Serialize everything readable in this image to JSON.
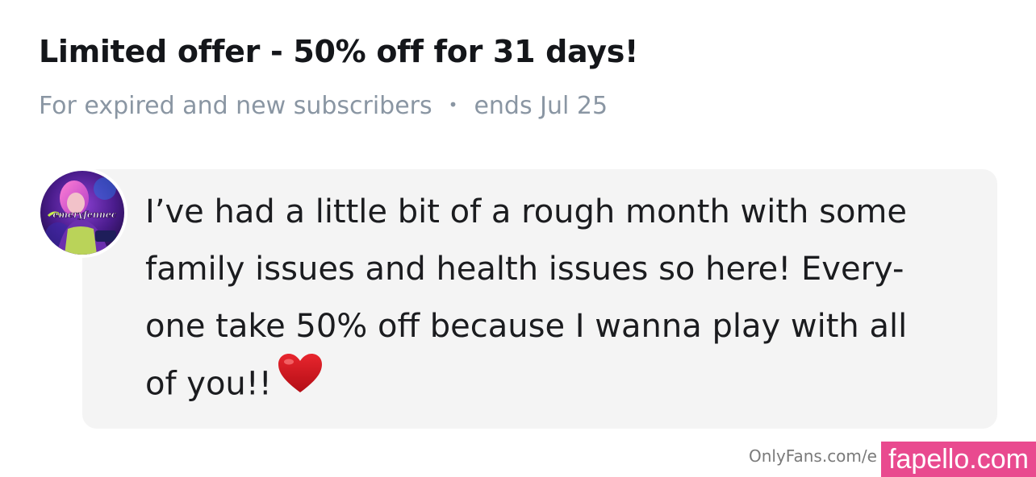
{
  "offer": {
    "title": "Limited offer - 50% off for 31 days!",
    "audience": "For expired and new subscribers",
    "separator": "•",
    "ends": "ends Jul 25"
  },
  "avatar": {
    "logo_text": "emeryfennec"
  },
  "message": {
    "lines": [
      "I’ve had a little bit of a rough month with some",
      "family issues and health issues so here! Every-",
      "one take 50% off because I wanna play with all",
      "of you!!"
    ],
    "emoji": "heart-icon"
  },
  "footer": {
    "site": "OnlyFans.com/e"
  },
  "watermark": {
    "text": "fapello.com",
    "color": "#e94a8f"
  },
  "colors": {
    "title": "#14161a",
    "meta": "#8a96a3",
    "bubble": "#f4f4f4",
    "heart": "#d4141c"
  }
}
